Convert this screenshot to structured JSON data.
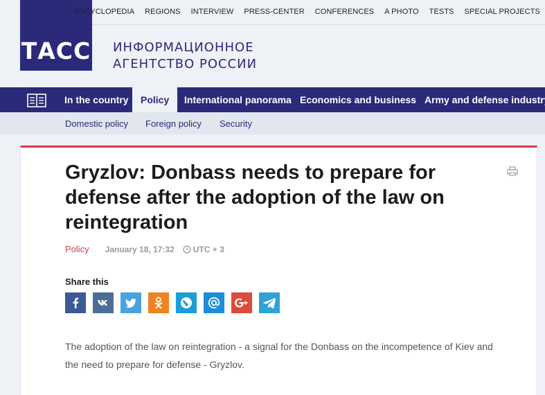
{
  "header": {
    "logo_text": "ТАСС",
    "agency_line1": "ИНФОРМАЦИОННОЕ",
    "agency_line2": "АГЕНТСТВО РОССИИ",
    "top_links": [
      "ENCYCLOPEDIA",
      "REGIONS",
      "INTERVIEW",
      "PRESS-CENTER",
      "CONFERENCES",
      "A PHOTO",
      "TESTS",
      "SPECIAL PROJECTS"
    ]
  },
  "main_nav": {
    "items": [
      "In the country",
      "Policy",
      "International panorama",
      "Economics and business",
      "Army and defense industry"
    ],
    "active": "Policy"
  },
  "sub_nav": {
    "items": [
      "Domestic policy",
      "Foreign policy",
      "Security"
    ]
  },
  "article": {
    "title": "Gryzlov: Donbass needs to prepare for defense after the adoption of the law on reintegration",
    "rubric": "Policy",
    "date": "January 18, 17:32",
    "timezone": "UTC + 3",
    "share_label": "Share this",
    "lead": "The adoption of the law on reintegration - a signal for the Donbass on the incompetence of Kiev and the need to prepare for defense - Gryzlov."
  },
  "share_buttons": [
    {
      "name": "facebook",
      "glyph": "f",
      "color": "#3b5998"
    },
    {
      "name": "vk",
      "glyph": "vk",
      "color": "#4a6e95"
    },
    {
      "name": "twitter",
      "glyph": "t",
      "color": "#4aa3e0"
    },
    {
      "name": "odnoklassniki",
      "glyph": "ok",
      "color": "#f08321"
    },
    {
      "name": "livejournal",
      "glyph": "lj",
      "color": "#1a9fd9"
    },
    {
      "name": "mail",
      "glyph": "@",
      "color": "#1e8dd8"
    },
    {
      "name": "google-plus",
      "glyph": "G+",
      "color": "#dd4b39"
    },
    {
      "name": "telegram",
      "glyph": "tg",
      "color": "#2fa3d8"
    }
  ],
  "colors": {
    "brand": "#2b2a7a",
    "accent": "#d83a4d",
    "background": "#eef1f6"
  }
}
